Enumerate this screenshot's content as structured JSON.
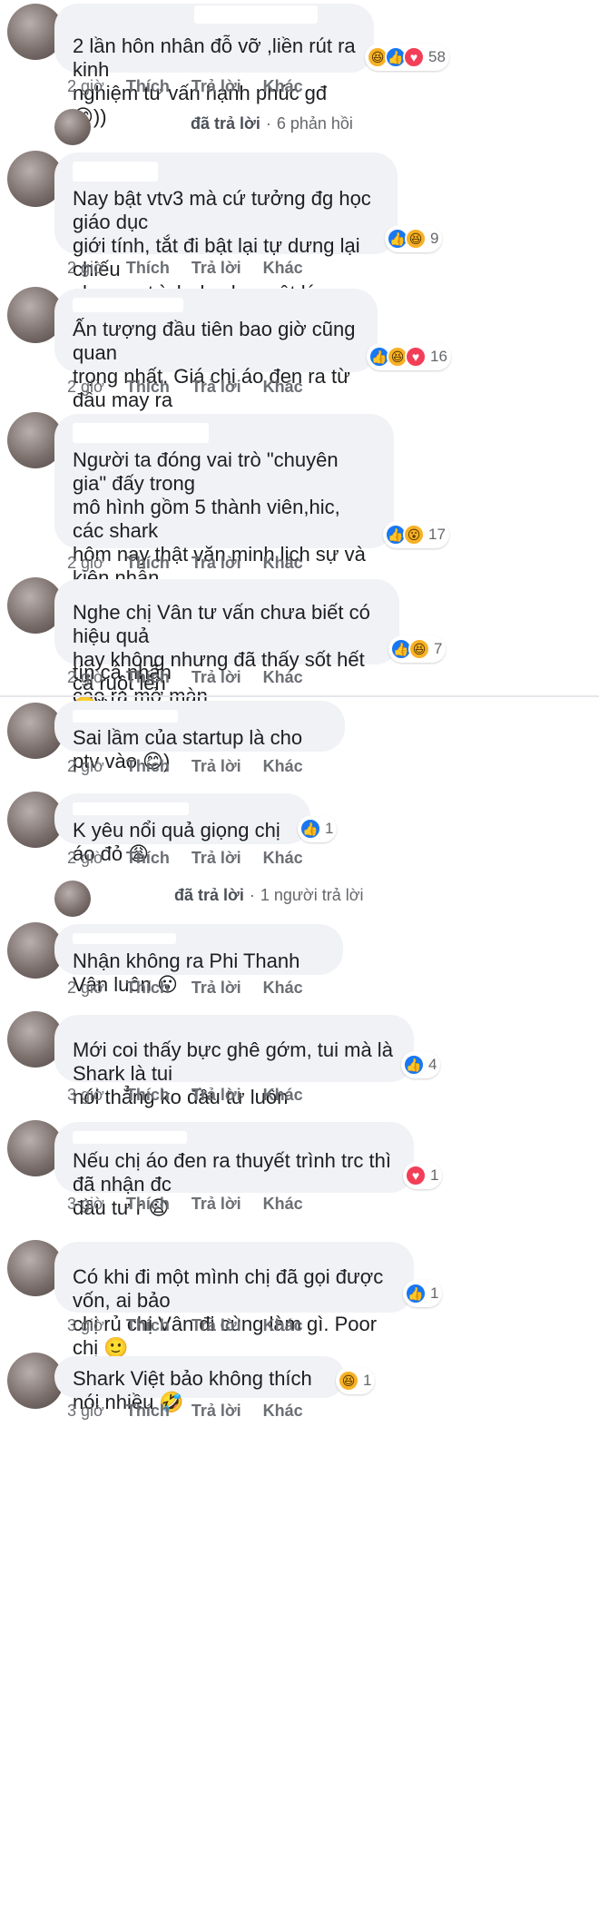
{
  "actions": {
    "like": "Thích",
    "reply": "Trả lời",
    "more": "Khác"
  },
  "comments": [
    {
      "text": "2 lần hôn nhân đỗ vỡ ,liền rút ra kinh\nnghiệm tư vấn hạnh phúc gđ 😊))",
      "time": "2 giờ",
      "reactions": [
        "haha-icon",
        "like-icon",
        "love-icon"
      ],
      "count": "58"
    },
    {
      "text": "Nay bật vtv3 mà cứ tưởng đg học giáo dục\ngiới tính, tắt đi bật lại tự dưng lại chiếu\nchương trình dạy học vật lý qua tv, ko bt hnay\ntivi của mình có vđ j ko....",
      "time": "2 giờ",
      "reactions": [
        "like-icon",
        "haha-icon"
      ],
      "count": "9"
    },
    {
      "text": "Ấn tượng đầu tiên bao giờ cũng quan\ntrọng nhất. Giá chị áo đen ra từ đầu may ra\ncó deal từ Shark Linh 😑😑😑",
      "time": "2 giờ",
      "reactions": [
        "like-icon",
        "haha-icon",
        "love-icon"
      ],
      "count": "16"
    },
    {
      "text": "Người ta đóng vai trò \"chuyên gia\" đấy trong\nmô hình gồm 5 thành viên,hic, các shark\nhôm nay thật văn minh lịch sự và kiên nhẫn\nchứ thực sự là điên với mụ ptv lắm rồi, thật\nsự sai lầm khi cho người ko có uy tín cá nhân\ncao ra mở màn",
      "time": "2 giờ",
      "reactions": [
        "like-icon",
        "wow-icon"
      ],
      "count": "17"
    },
    {
      "text": "Nghe chị Vân tư vấn chưa biết có hiệu quả\nhay không nhưng đã thấy sốt hết cả ruột lên\n🙂))",
      "time": "2 giờ",
      "reactions": [
        "like-icon",
        "haha-icon"
      ],
      "count": "7"
    },
    {
      "text": "Sai lầm của startup là cho ptv vào 😊)",
      "time": "2 giờ",
      "reactions": [],
      "count": ""
    },
    {
      "text": "K yêu nổi quả giọng chị áo đỏ 😩",
      "time": "2 giờ",
      "reactions": [
        "like-icon"
      ],
      "count": "1"
    },
    {
      "text": "Nhận không ra Phi Thanh Vân luôn 😮",
      "time": "2 giờ",
      "reactions": [],
      "count": ""
    },
    {
      "text": "Mới coi thấy bực ghê gớm, tui mà là Shark là tui\nnói thẳng ko đầu tư luôn",
      "time": "3 giờ",
      "reactions": [
        "like-icon"
      ],
      "count": "4"
    },
    {
      "text": "Nếu chị áo đen ra thuyết trình trc thì đã nhận đc\nđầu tư r 😦",
      "time": "3 giờ",
      "reactions": [
        "love-icon"
      ],
      "count": "1"
    },
    {
      "text": "Có khi đi một mình chị đã gọi được vốn, ai bảo\nchị rủ chị Vân đi cùng làm gì. Poor chị 🙂",
      "time": "3 giờ",
      "reactions": [
        "like-icon"
      ],
      "count": "1"
    },
    {
      "text": "Shark Việt bảo không thích nói nhiều 🤣",
      "time": "3 giờ",
      "reactions": [
        "haha-icon"
      ],
      "count": "1"
    }
  ],
  "reply_threads": [
    {
      "who": "đã trả lời",
      "count_text": "6 phản hồi"
    },
    {
      "who": "đã trả lời",
      "count_text": "1 người trả lời"
    }
  ],
  "colors": {
    "bubble": "#f0f2f5",
    "like": "#1877f2",
    "love": "#f33e58",
    "haha": "#f7b125",
    "meta": "#65676b"
  }
}
